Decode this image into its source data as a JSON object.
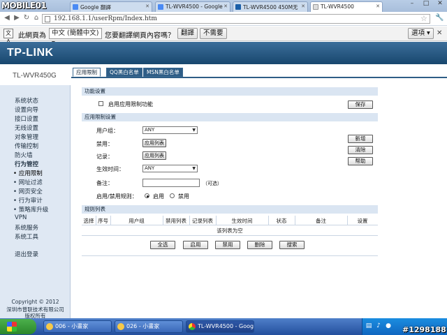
{
  "browser": {
    "logo_text": "MOBILE01",
    "tabs": [
      {
        "label": "Google 翻譯",
        "color": "#4a8af4"
      },
      {
        "label": "TL-WVR4500 - Google",
        "color": "#4a8af4"
      },
      {
        "label": "TL-WVR4500 450M无",
        "color": "#1b5fa8"
      },
      {
        "label": "TL-WVR4500",
        "color": "#dddddd"
      }
    ],
    "url": "192.168.1.1/userRpm/Index.htm"
  },
  "translate_bar": {
    "prefix": "此網頁為",
    "language": "中文 (簡體中文)",
    "question": "您要翻譯網頁內容嗎？",
    "translate_button": "翻譯",
    "decline_button": "不需要",
    "options_button": "選項"
  },
  "header": {
    "brand": "TP-LINK",
    "model": "TL-WVR450G"
  },
  "top_nav": {
    "tabs": [
      "应用限制",
      "QQ黑白名单",
      "MSN黑白名单"
    ]
  },
  "sidebar": {
    "items": [
      {
        "label": "系统状态",
        "bold": false,
        "sub": false
      },
      {
        "label": "设置向导",
        "bold": false,
        "sub": false
      },
      {
        "label": "接口设置",
        "bold": false,
        "sub": false
      },
      {
        "label": "无线设置",
        "bold": false,
        "sub": false
      },
      {
        "label": "对象管理",
        "bold": false,
        "sub": false
      },
      {
        "label": "传输控制",
        "bold": false,
        "sub": false
      },
      {
        "label": "防火墙",
        "bold": false,
        "sub": false
      },
      {
        "label": "行为管控",
        "bold": true,
        "sub": false
      },
      {
        "label": "• 应用限制",
        "bold": false,
        "sub": true
      },
      {
        "label": "• 网址过滤",
        "bold": false,
        "sub": true
      },
      {
        "label": "• 网页安全",
        "bold": false,
        "sub": true
      },
      {
        "label": "• 行为审计",
        "bold": false,
        "sub": true
      },
      {
        "label": "• 策略库升级",
        "bold": false,
        "sub": true
      },
      {
        "label": "VPN",
        "bold": false,
        "sub": false
      },
      {
        "label": "系统服务",
        "bold": false,
        "sub": false
      },
      {
        "label": "系统工具",
        "bold": false,
        "sub": false
      },
      {
        "label": "退出登录",
        "bold": false,
        "sub": false
      }
    ],
    "copyright": "Copyright © 2012",
    "company": "深圳市普联技术有限公司",
    "rights": "版权所有"
  },
  "feature_section": {
    "title": "功能设置",
    "enable_label": "启用应用限制功能",
    "save_button": "保存"
  },
  "rule_section": {
    "title": "应用限制设置",
    "user_group_label": "用户组：",
    "user_group_value": "ANY",
    "block_label": "禁用：",
    "block_button": "应用列表",
    "log_label": "记录：",
    "log_button": "应用列表",
    "time_label": "生效时间：",
    "time_value": "ANY",
    "note_label": "备注：",
    "note_value": "",
    "note_hint": "（可选）",
    "toggle_label": "启用/禁用规则：",
    "enable_option": "启用",
    "disable_option": "禁用",
    "add_button": "新增",
    "clear_button": "清除",
    "help_button": "帮助"
  },
  "rule_list": {
    "title": "规则列表",
    "columns": [
      "选择",
      "序号",
      "用户组",
      "禁用列表",
      "记录列表",
      "生效时间",
      "状态",
      "备注",
      "设置"
    ],
    "empty_text": "该列表为空",
    "actions": [
      "全选",
      "启用",
      "禁用",
      "删除",
      "搜索"
    ]
  },
  "taskbar": {
    "tasks": [
      "006 - 小畫家",
      "026 - 小畫家",
      "TL-WVR4500 - Goog..."
    ],
    "watermark": "#1298188"
  }
}
